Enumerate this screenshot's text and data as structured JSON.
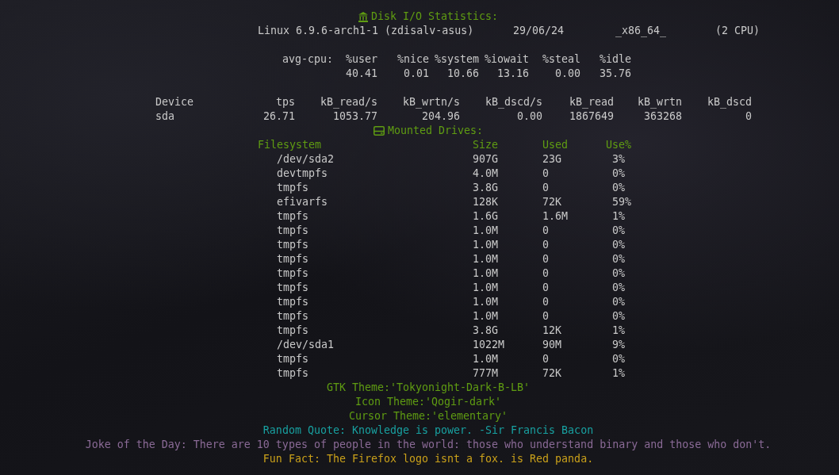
{
  "disk_io": {
    "title": "Disk I/O Statistics:",
    "system": [
      "Linux 6.9.6-arch1-1 (zdisalv-asus)",
      "29/06/24",
      "_x86_64_",
      "(2 CPU)"
    ],
    "cpu": {
      "label": "avg-cpu:",
      "columns": [
        "%user",
        "%nice",
        "%system",
        "%iowait",
        "%steal",
        "%idle"
      ],
      "values": [
        "40.41",
        "0.01",
        "10.66",
        "13.16",
        "0.00",
        "35.76"
      ]
    },
    "devices": {
      "columns": [
        "Device",
        "tps",
        "kB_read/s",
        "kB_wrtn/s",
        "kB_dscd/s",
        "kB_read",
        "kB_wrtn",
        "kB_dscd"
      ],
      "rows": [
        [
          "sda",
          "26.71",
          "1053.77",
          "204.96",
          "0.00",
          "1867649",
          "363268",
          "0"
        ]
      ]
    }
  },
  "mounted_drives": {
    "title": "Mounted Drives:",
    "columns": [
      "Filesystem",
      "Size",
      "Used",
      "Use%"
    ],
    "rows": [
      [
        "/dev/sda2",
        "907G",
        "23G",
        "3%"
      ],
      [
        "devtmpfs",
        "4.0M",
        "0",
        "0%"
      ],
      [
        "tmpfs",
        "3.8G",
        "0",
        "0%"
      ],
      [
        "efivarfs",
        "128K",
        "72K",
        "59%"
      ],
      [
        "tmpfs",
        "1.6G",
        "1.6M",
        "1%"
      ],
      [
        "tmpfs",
        "1.0M",
        "0",
        "0%"
      ],
      [
        "tmpfs",
        "1.0M",
        "0",
        "0%"
      ],
      [
        "tmpfs",
        "1.0M",
        "0",
        "0%"
      ],
      [
        "tmpfs",
        "1.0M",
        "0",
        "0%"
      ],
      [
        "tmpfs",
        "1.0M",
        "0",
        "0%"
      ],
      [
        "tmpfs",
        "1.0M",
        "0",
        "0%"
      ],
      [
        "tmpfs",
        "1.0M",
        "0",
        "0%"
      ],
      [
        "tmpfs",
        "3.8G",
        "12K",
        "1%"
      ],
      [
        "/dev/sda1",
        "1022M",
        "90M",
        "9%"
      ],
      [
        "tmpfs",
        "1.0M",
        "0",
        "0%"
      ],
      [
        "tmpfs",
        "777M",
        "72K",
        "1%"
      ]
    ]
  },
  "info_lines": [
    {
      "text": "GTK Theme:'Tokyonight-Dark-B-LB'",
      "color": "#5f9c12"
    },
    {
      "text": "Icon Theme:'Qogir-dark'",
      "color": "#5f9c12"
    },
    {
      "text": "Cursor Theme:'elementary'",
      "color": "#5f9c12"
    },
    {
      "text": "Random Quote: Knowledge is power. -Sir Francis Bacon",
      "color": "#18a0a0"
    },
    {
      "text": "Joke of the Day: There are 10 types of people in the world: those who understand binary and those who don't.",
      "color": "#8a6a96"
    },
    {
      "text": "Fun Fact: The Firefox logo isnt a fox. is Red panda.",
      "color": "#c9a01a"
    }
  ]
}
